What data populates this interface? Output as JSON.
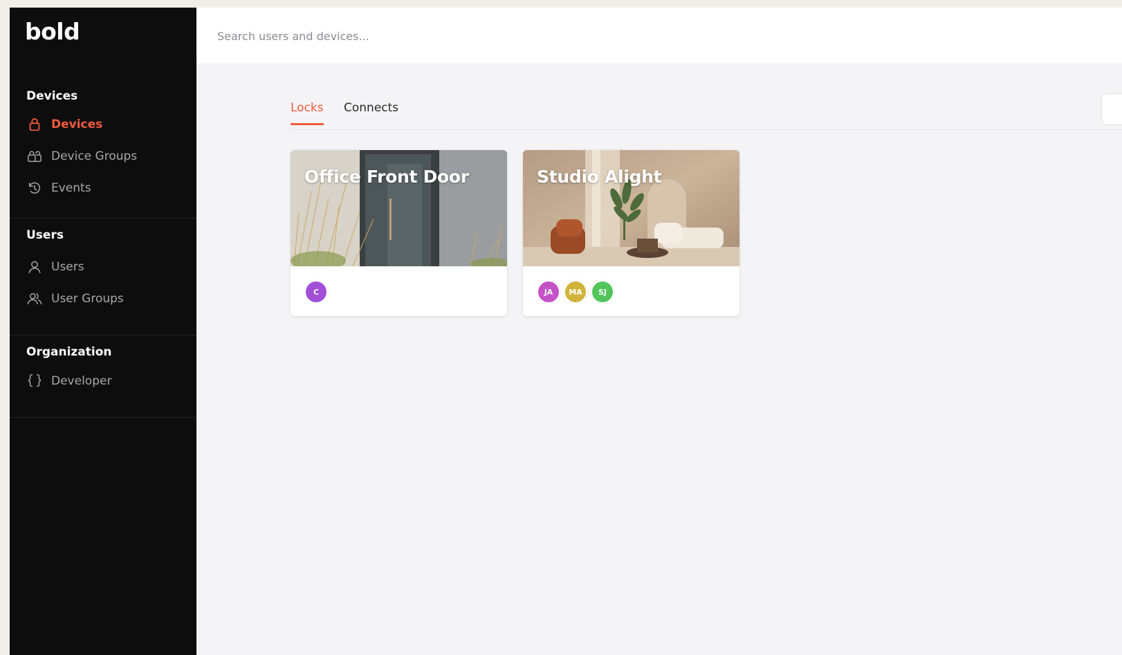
{
  "brand": {
    "logo_text": "bold"
  },
  "sidebar": {
    "sections": [
      {
        "title": "Devices",
        "items": [
          {
            "label": "Devices",
            "icon": "lock-icon",
            "active": true
          },
          {
            "label": "Device Groups",
            "icon": "device-groups-icon",
            "active": false
          },
          {
            "label": "Events",
            "icon": "history-icon",
            "active": false
          }
        ]
      },
      {
        "title": "Users",
        "items": [
          {
            "label": "Users",
            "icon": "user-icon",
            "active": false
          },
          {
            "label": "User Groups",
            "icon": "user-group-icon",
            "active": false
          }
        ]
      },
      {
        "title": "Organization",
        "items": [
          {
            "label": "Developer",
            "icon": "braces-icon",
            "active": false
          }
        ]
      }
    ]
  },
  "search": {
    "placeholder": "Search users and devices...",
    "value": ""
  },
  "tabs": [
    {
      "label": "Locks",
      "active": true
    },
    {
      "label": "Connects",
      "active": false
    }
  ],
  "devices": [
    {
      "title": "Office Front Door",
      "avatars": [
        {
          "initials": "C",
          "color": "#a24fd8"
        }
      ]
    },
    {
      "title": "Studio Alight",
      "avatars": [
        {
          "initials": "JA",
          "color": "#c553c8"
        },
        {
          "initials": "MA",
          "color": "#d2b33a"
        },
        {
          "initials": "SJ",
          "color": "#52c55a"
        }
      ]
    }
  ],
  "colors": {
    "accent": "#f05a3d",
    "sidebar_bg": "#0d0d0d",
    "main_bg": "#f4f4f6"
  }
}
